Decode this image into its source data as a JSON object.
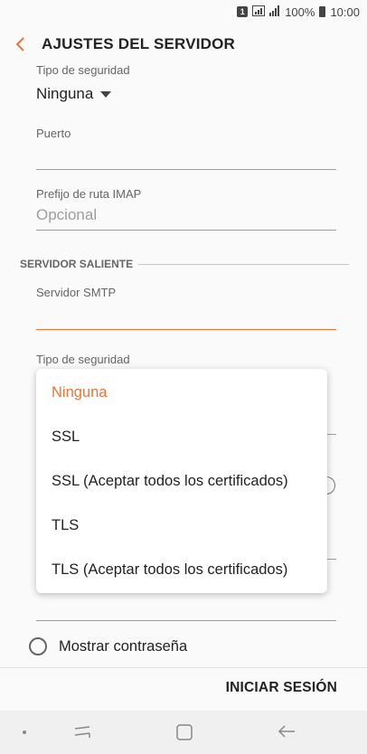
{
  "status_bar": {
    "sim": "1",
    "battery_percent": "100%",
    "time": "10:00"
  },
  "header": {
    "title": "AJUSTES DEL SERVIDOR"
  },
  "incoming": {
    "security_label": "Tipo de seguridad",
    "security_value": "Ninguna",
    "port_label": "Puerto",
    "port_value": "",
    "imap_prefix_label": "Prefijo de ruta IMAP",
    "imap_prefix_placeholder": "Opcional"
  },
  "outgoing": {
    "section_title": "SERVIDOR SALIENTE",
    "smtp_label": "Servidor SMTP",
    "smtp_value": "",
    "security_label": "Tipo de seguridad"
  },
  "security_menu": {
    "selected_index": 0,
    "options": [
      "Ninguna",
      "SSL",
      "SSL (Aceptar todos los certificados)",
      "TLS",
      "TLS (Aceptar todos los certificados)"
    ]
  },
  "show_password": {
    "label": "Mostrar contraseña",
    "checked": false
  },
  "footer": {
    "signin_label": "INICIAR SESIÓN"
  },
  "colors": {
    "accent": "#e8743b",
    "text": "#222222",
    "secondary_text": "#666666"
  }
}
